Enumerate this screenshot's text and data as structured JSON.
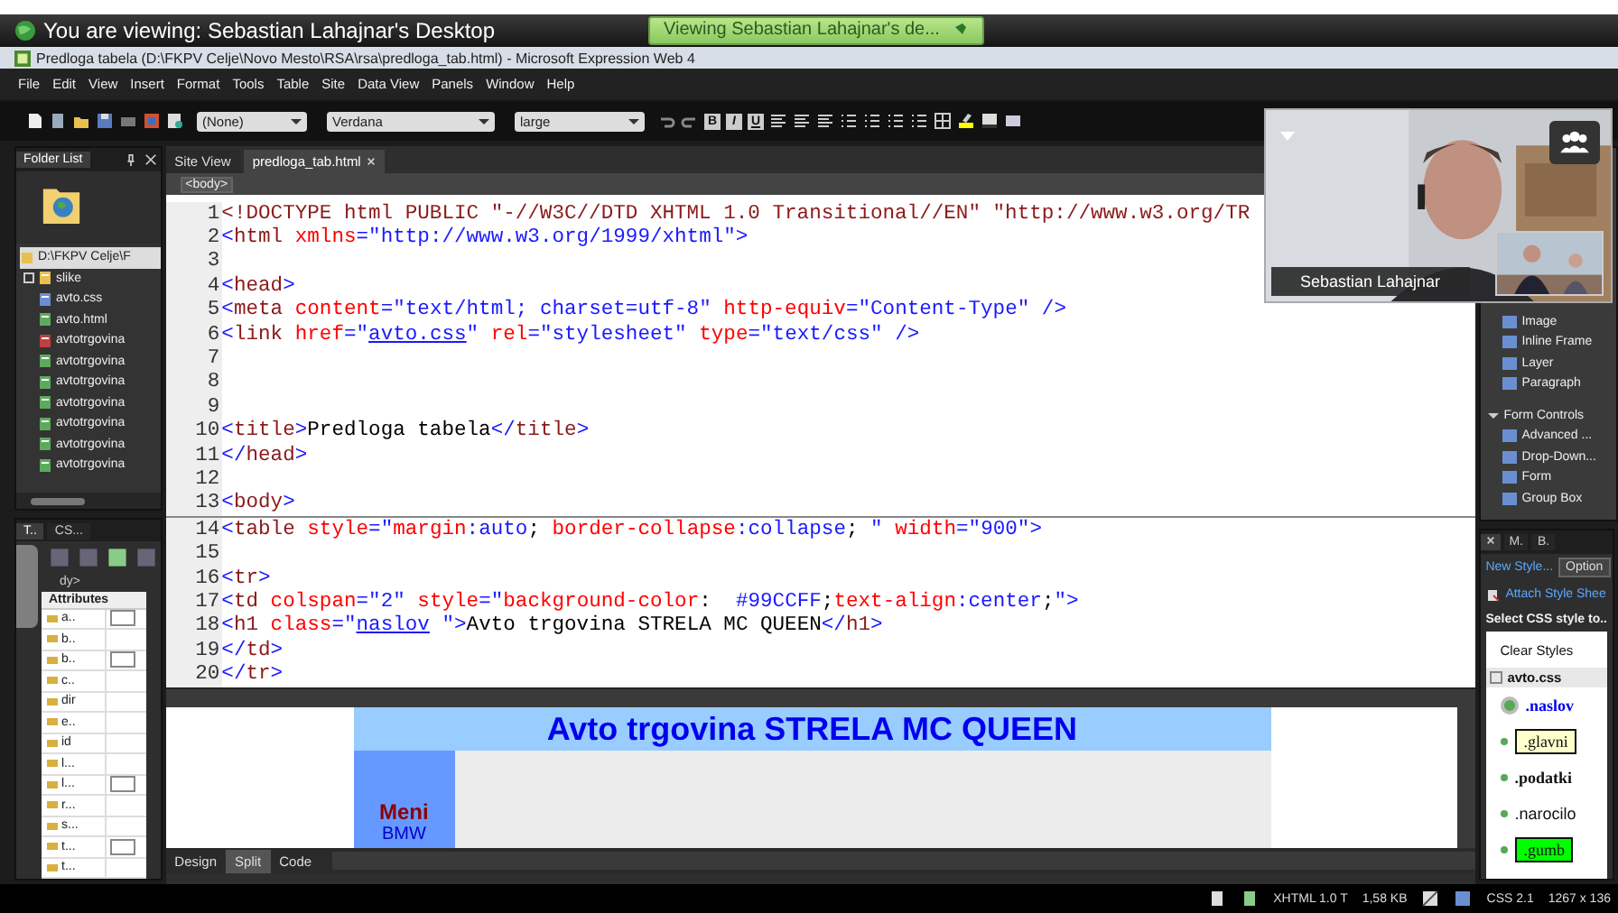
{
  "viewer_bar": {
    "title": "You are viewing: Sebastian Lahajnar's Desktop",
    "notification": "Viewing Sebastian Lahajnar's de..."
  },
  "window": {
    "title": "Predloga tabela (D:\\FKPV Celje\\Novo Mesto\\RSA\\rsa\\predloga_tab.html) - Microsoft Expression Web 4"
  },
  "menu": [
    "File",
    "Edit",
    "View",
    "Insert",
    "Format",
    "Tools",
    "Table",
    "Site",
    "Data View",
    "Panels",
    "Window",
    "Help"
  ],
  "toolbar": {
    "style": "(None)",
    "font": "Verdana",
    "size": "large",
    "format_buttons": [
      "B",
      "I",
      "U"
    ]
  },
  "folder_list": {
    "title": "Folder List",
    "root": {
      "label": "D:\\FKPV Celje\\F",
      "selected": true,
      "children": [
        {
          "label": "slike",
          "kind": "folder",
          "selected": false
        },
        {
          "label": "avto.css",
          "kind": "css",
          "selected": false
        },
        {
          "label": "avto.html",
          "kind": "html",
          "selected": false
        },
        {
          "label": "avtotrgovina",
          "kind": "page",
          "selected": false
        },
        {
          "label": "avtotrgovina",
          "kind": "html",
          "selected": false
        },
        {
          "label": "avtotrgovina",
          "kind": "html",
          "selected": false
        },
        {
          "label": "avtotrgovina",
          "kind": "html",
          "selected": false
        },
        {
          "label": "avtotrgovina",
          "kind": "html",
          "selected": false
        },
        {
          "label": "avtotrgovina",
          "kind": "html",
          "selected": false
        },
        {
          "label": "avtotrgovina",
          "kind": "html",
          "selected": false
        }
      ]
    }
  },
  "tag_properties": {
    "tabs": [
      {
        "label": "T..",
        "selected": true
      },
      {
        "label": "CS...",
        "selected": false
      }
    ],
    "breadcrumb": "dy>",
    "header": "Attributes",
    "rows": [
      {
        "name": "a..",
        "kind": "swatch"
      },
      {
        "name": "b..",
        "kind": "text"
      },
      {
        "name": "b..",
        "kind": "swatch"
      },
      {
        "name": "c..",
        "kind": "text"
      },
      {
        "name": "dir",
        "kind": "text"
      },
      {
        "name": "e..",
        "kind": "text"
      },
      {
        "name": "id",
        "kind": "text"
      },
      {
        "name": "l...",
        "kind": "text"
      },
      {
        "name": "l...",
        "kind": "swatch"
      },
      {
        "name": "r...",
        "kind": "text"
      },
      {
        "name": "s...",
        "kind": "text"
      },
      {
        "name": "t...",
        "kind": "swatch"
      },
      {
        "name": "t...",
        "kind": "text"
      }
    ]
  },
  "editor": {
    "tabs": [
      {
        "label": "Site View",
        "selected": false
      },
      {
        "label": "predloga_tab.html",
        "selected": true
      }
    ],
    "breadcrumb": "<body>",
    "lines": [
      {
        "n": "1",
        "ruled": false,
        "parts": [
          {
            "t": "<!DOCTYPE html PUBLIC \"-//W3C//DTD XHTML 1.0 Transitional//EN\" \"http://www.w3.org/TR",
            "kind": "tag"
          }
        ]
      },
      {
        "n": "2",
        "ruled": false,
        "parts": [
          {
            "t": "<",
            "kind": "punct"
          },
          {
            "t": "html ",
            "kind": "tag"
          },
          {
            "t": "xmlns",
            "kind": "attr"
          },
          {
            "t": "=\"http://www.w3.org/1999/xhtml\">",
            "kind": "val"
          }
        ]
      },
      {
        "n": "3",
        "ruled": false
      },
      {
        "n": "4",
        "ruled": false,
        "parts": [
          {
            "t": "<",
            "kind": "punct"
          },
          {
            "t": "head",
            "kind": "tag"
          },
          {
            "t": ">",
            "kind": "punct"
          }
        ]
      },
      {
        "n": "5",
        "ruled": false,
        "parts": [
          {
            "t": "<",
            "kind": "punct"
          },
          {
            "t": "meta ",
            "kind": "tag"
          },
          {
            "t": "content",
            "kind": "attr"
          },
          {
            "t": "=\"text/html; charset=utf-8\" ",
            "kind": "val"
          },
          {
            "t": "http-equiv",
            "kind": "attr"
          },
          {
            "t": "=\"Content-Type\" />",
            "kind": "val"
          }
        ]
      },
      {
        "n": "6",
        "ruled": false,
        "parts": [
          {
            "t": "<",
            "kind": "punct"
          },
          {
            "t": "link ",
            "kind": "tag"
          },
          {
            "t": "href",
            "kind": "attr"
          },
          {
            "t": "=\"",
            "kind": "val"
          },
          {
            "t": "avto.css",
            "kind": "link"
          },
          {
            "t": "\" ",
            "kind": "val"
          },
          {
            "t": "rel",
            "kind": "attr"
          },
          {
            "t": "=\"stylesheet\" ",
            "kind": "val"
          },
          {
            "t": "type",
            "kind": "attr"
          },
          {
            "t": "=\"text/css\" />",
            "kind": "val"
          }
        ]
      },
      {
        "n": "7",
        "ruled": false
      },
      {
        "n": "8",
        "ruled": false
      },
      {
        "n": "9",
        "ruled": false
      },
      {
        "n": "10",
        "ruled": false,
        "parts": [
          {
            "t": "<",
            "kind": "punct"
          },
          {
            "t": "title",
            "kind": "tag"
          },
          {
            "t": ">",
            "kind": "punct"
          },
          {
            "t": "Predloga tabela",
            "kind": "text"
          },
          {
            "t": "</",
            "kind": "punct"
          },
          {
            "t": "title",
            "kind": "tag"
          },
          {
            "t": ">",
            "kind": "punct"
          }
        ]
      },
      {
        "n": "11",
        "ruled": false,
        "parts": [
          {
            "t": "</",
            "kind": "punct"
          },
          {
            "t": "head",
            "kind": "tag"
          },
          {
            "t": ">",
            "kind": "punct"
          }
        ]
      },
      {
        "n": "12",
        "ruled": false
      },
      {
        "n": "13",
        "ruled": false,
        "parts": [
          {
            "t": "<",
            "kind": "punct"
          },
          {
            "t": "body",
            "kind": "tag"
          },
          {
            "t": ">",
            "kind": "punct"
          }
        ]
      },
      {
        "n": "14",
        "ruled": true,
        "parts": [
          {
            "t": "<",
            "kind": "punct"
          },
          {
            "t": "table ",
            "kind": "tag"
          },
          {
            "t": "style",
            "kind": "attr"
          },
          {
            "t": "=\"",
            "kind": "val"
          },
          {
            "t": "margin",
            "kind": "attr"
          },
          {
            "t": ":auto",
            "kind": "val"
          },
          {
            "t": "; ",
            "kind": "text"
          },
          {
            "t": "border-collapse",
            "kind": "attr"
          },
          {
            "t": ":collapse",
            "kind": "val"
          },
          {
            "t": "; ",
            "kind": "text"
          },
          {
            "t": "\" ",
            "kind": "val"
          },
          {
            "t": "width",
            "kind": "attr"
          },
          {
            "t": "=\"900\">",
            "kind": "val"
          }
        ]
      },
      {
        "n": "15",
        "ruled": false
      },
      {
        "n": "16",
        "ruled": false,
        "parts": [
          {
            "t": "<",
            "kind": "punct"
          },
          {
            "t": "tr",
            "kind": "tag"
          },
          {
            "t": ">",
            "kind": "punct"
          }
        ]
      },
      {
        "n": "17",
        "ruled": false,
        "parts": [
          {
            "t": "<",
            "kind": "punct"
          },
          {
            "t": "td ",
            "kind": "tag"
          },
          {
            "t": "colspan",
            "kind": "attr"
          },
          {
            "t": "=\"2\" ",
            "kind": "val"
          },
          {
            "t": "style",
            "kind": "attr"
          },
          {
            "t": "=\"",
            "kind": "val"
          },
          {
            "t": "background-color",
            "kind": "attr"
          },
          {
            "t": ":  ",
            "kind": "text"
          },
          {
            "t": "#99CCFF",
            "kind": "val"
          },
          {
            "t": ";",
            "kind": "text"
          },
          {
            "t": "text-align",
            "kind": "attr"
          },
          {
            "t": ":center",
            "kind": "val"
          },
          {
            "t": ";",
            "kind": "text"
          },
          {
            "t": "\">",
            "kind": "val"
          }
        ]
      },
      {
        "n": "18",
        "ruled": false,
        "parts": [
          {
            "t": "<",
            "kind": "punct"
          },
          {
            "t": "h1 ",
            "kind": "tag"
          },
          {
            "t": "class",
            "kind": "attr"
          },
          {
            "t": "=\"",
            "kind": "val"
          },
          {
            "t": "naslov",
            "kind": "link"
          },
          {
            "t": " \">",
            "kind": "val"
          },
          {
            "t": "Avto trgovina STRELA MC QUEEN",
            "kind": "text"
          },
          {
            "t": "</",
            "kind": "punct"
          },
          {
            "t": "h1",
            "kind": "tag"
          },
          {
            "t": ">",
            "kind": "punct"
          }
        ]
      },
      {
        "n": "19",
        "ruled": false,
        "parts": [
          {
            "t": "</",
            "kind": "punct"
          },
          {
            "t": "td",
            "kind": "tag"
          },
          {
            "t": ">",
            "kind": "punct"
          }
        ]
      },
      {
        "n": "20",
        "ruled": false,
        "parts": [
          {
            "t": "</",
            "kind": "punct"
          },
          {
            "t": "tr",
            "kind": "tag"
          },
          {
            "t": ">",
            "kind": "punct"
          }
        ]
      }
    ]
  },
  "design_view": {
    "heading": "Avto trgovina STRELA MC QUEEN",
    "menu_title": "Meni",
    "menu_item": "BMW"
  },
  "view_tabs": [
    {
      "label": "Design",
      "selected": false
    },
    {
      "label": "Split",
      "selected": true
    },
    {
      "label": "Code",
      "selected": false
    }
  ],
  "toolbox": {
    "items": [
      {
        "label": "Image",
        "kind": "item"
      },
      {
        "label": "Inline Frame",
        "kind": "item"
      },
      {
        "label": "Layer",
        "kind": "item"
      },
      {
        "label": "Paragraph",
        "kind": "item"
      },
      {
        "label": "Form Controls",
        "kind": "section"
      },
      {
        "label": "Advanced ...",
        "kind": "item"
      },
      {
        "label": "Drop-Down...",
        "kind": "item"
      },
      {
        "label": "Form",
        "kind": "item"
      },
      {
        "label": "Group Box",
        "kind": "item"
      }
    ]
  },
  "styles_panel": {
    "tabs": [
      {
        "label": "M.",
        "selected": false
      },
      {
        "label": "B.",
        "selected": false
      }
    ],
    "new_style": "New Style...",
    "options": "Option",
    "attach": "Attach Style Shee",
    "select_label": "Select CSS style to..",
    "clear": "Clear Styles",
    "file": "avto.css",
    "styles": [
      {
        "name": ".naslov",
        "kind": "title",
        "used": true
      },
      {
        "name": ".glavni",
        "kind": "boxed",
        "color": "#ffffcc",
        "used": false
      },
      {
        "name": ".podatki",
        "kind": "serif",
        "used": false
      },
      {
        "name": ".narocilo",
        "kind": "sans",
        "used": false
      },
      {
        "name": ".gumb",
        "kind": "boxed",
        "color": "#00ff00",
        "used": false
      }
    ]
  },
  "video": {
    "name": "Sebastian Lahajnar"
  },
  "status_bar": {
    "doctype": "XHTML 1.0 T",
    "size": "1,58 KB",
    "css": "CSS 2.1",
    "dimensions": "1267 x 136"
  }
}
